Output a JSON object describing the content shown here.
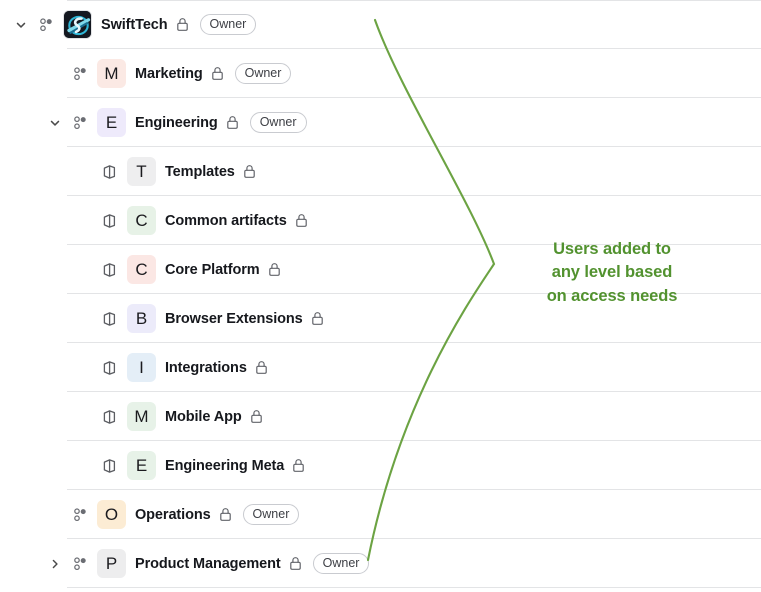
{
  "org": {
    "logo_icon": "swifttech-logo-icon",
    "name": "SwiftTech",
    "lock_icon": "lock-icon",
    "badge": "Owner",
    "chevron_icon": "chevron-down-icon",
    "people_icon": "people-icon"
  },
  "annotation": {
    "text": "Users added to\nany level based\non access needs",
    "color": "#52922f"
  },
  "icons": {
    "chevron_down": "chevron-down-icon",
    "chevron_right": "chevron-right-icon",
    "people": "people-icon",
    "project": "project-cube-icon",
    "lock": "lock-icon"
  },
  "rows": [
    {
      "type": "organization",
      "indent": 0,
      "chevron": "down",
      "entity_icon": "people-icon",
      "avatar_letter": "",
      "avatar_color": "#111318",
      "is_logo": true,
      "name": "SwiftTech",
      "lock": true,
      "badge": "Owner"
    },
    {
      "type": "team",
      "indent": 1,
      "chevron": "none",
      "entity_icon": "people-icon",
      "avatar_letter": "M",
      "avatar_color": "#fbe9e4",
      "is_logo": false,
      "name": "Marketing",
      "lock": true,
      "badge": "Owner"
    },
    {
      "type": "team",
      "indent": 1,
      "chevron": "down",
      "entity_icon": "people-icon",
      "avatar_letter": "E",
      "avatar_color": "#eeeafb",
      "is_logo": false,
      "name": "Engineering",
      "lock": true,
      "badge": "Owner"
    },
    {
      "type": "project",
      "indent": 2,
      "chevron": "none",
      "entity_icon": "project-cube-icon",
      "avatar_letter": "T",
      "avatar_color": "#eeeeef",
      "is_logo": false,
      "name": "Templates",
      "lock": true,
      "badge": null
    },
    {
      "type": "project",
      "indent": 2,
      "chevron": "none",
      "entity_icon": "project-cube-icon",
      "avatar_letter": "C",
      "avatar_color": "#e7f2e7",
      "is_logo": false,
      "name": "Common artifacts",
      "lock": true,
      "badge": null
    },
    {
      "type": "project",
      "indent": 2,
      "chevron": "none",
      "entity_icon": "project-cube-icon",
      "avatar_letter": "C",
      "avatar_color": "#fbe7e4",
      "is_logo": false,
      "name": "Core Platform",
      "lock": true,
      "badge": null
    },
    {
      "type": "project",
      "indent": 2,
      "chevron": "none",
      "entity_icon": "project-cube-icon",
      "avatar_letter": "B",
      "avatar_color": "#ecebfa",
      "is_logo": false,
      "name": "Browser Extensions",
      "lock": true,
      "badge": null
    },
    {
      "type": "project",
      "indent": 2,
      "chevron": "none",
      "entity_icon": "project-cube-icon",
      "avatar_letter": "I",
      "avatar_color": "#e4eef7",
      "is_logo": false,
      "name": "Integrations",
      "lock": true,
      "badge": null
    },
    {
      "type": "project",
      "indent": 2,
      "chevron": "none",
      "entity_icon": "project-cube-icon",
      "avatar_letter": "M",
      "avatar_color": "#e7f2e8",
      "is_logo": false,
      "name": "Mobile App",
      "lock": true,
      "badge": null
    },
    {
      "type": "project",
      "indent": 2,
      "chevron": "none",
      "entity_icon": "project-cube-icon",
      "avatar_letter": "E",
      "avatar_color": "#e7f2e8",
      "is_logo": false,
      "name": "Engineering Meta",
      "lock": true,
      "badge": null
    },
    {
      "type": "team",
      "indent": 1,
      "chevron": "none",
      "entity_icon": "people-icon",
      "avatar_letter": "O",
      "avatar_color": "#fcecd4",
      "is_logo": false,
      "name": "Operations",
      "lock": true,
      "badge": "Owner"
    },
    {
      "type": "team",
      "indent": 1,
      "chevron": "right",
      "entity_icon": "people-icon",
      "avatar_letter": "P",
      "avatar_color": "#ededee",
      "is_logo": false,
      "name": "Product Management",
      "lock": true,
      "badge": "Owner"
    }
  ]
}
